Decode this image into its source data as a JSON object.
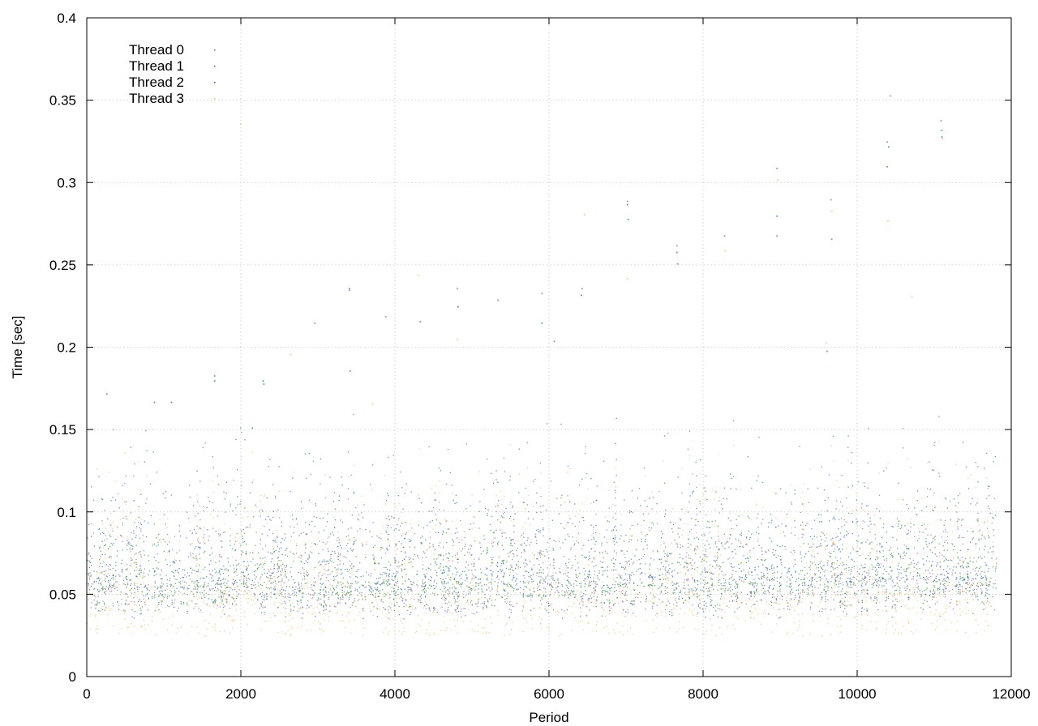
{
  "chart_data": {
    "type": "scatter",
    "title": "",
    "xlabel": "Period",
    "ylabel": "Time [sec]",
    "xlim": [
      0,
      12000
    ],
    "ylim": [
      0,
      0.4
    ],
    "x_ticks": [
      0,
      2000,
      4000,
      6000,
      8000,
      10000,
      12000
    ],
    "y_ticks": [
      0,
      0.05,
      0.1,
      0.15,
      0.2,
      0.25,
      0.3,
      0.35,
      0.4
    ],
    "x_tick_labels": [
      "0",
      "2000",
      "4000",
      "6000",
      "8000",
      "10000",
      "12000"
    ],
    "y_tick_labels": [
      "0",
      "0.05",
      "0.1",
      "0.15",
      "0.2",
      "0.25",
      "0.3",
      "0.35",
      "0.4"
    ],
    "grid": true,
    "legend_position": "top-left",
    "x_range_of_data": [
      0,
      11800
    ],
    "series": [
      {
        "name": "Thread 0",
        "color": "#9467bd",
        "summary": {
          "typical_low": 0.04,
          "typical_high": 0.11,
          "center": 0.058
        },
        "outliers": [
          [
            2950,
            0.215
          ],
          [
            3400,
            0.235
          ],
          [
            3870,
            0.219
          ],
          [
            4800,
            0.236
          ],
          [
            5900,
            0.233
          ],
          [
            6420,
            0.236
          ],
          [
            7010,
            0.289
          ],
          [
            7650,
            0.262
          ],
          [
            8270,
            0.268
          ],
          [
            8950,
            0.309
          ],
          [
            9650,
            0.29
          ],
          [
            10380,
            0.325
          ],
          [
            10420,
            0.353
          ],
          [
            11080,
            0.338
          ],
          [
            9600,
            0.198
          ]
        ]
      },
      {
        "name": "Thread 1",
        "color": "#2ca02c",
        "summary": {
          "typical_low": 0.04,
          "typical_high": 0.1,
          "center": 0.057
        },
        "outliers": [
          [
            1650,
            0.183
          ],
          [
            2290,
            0.178
          ],
          [
            3410,
            0.186
          ],
          [
            4320,
            0.216
          ],
          [
            5330,
            0.229
          ],
          [
            6060,
            0.204
          ],
          [
            7020,
            0.278
          ],
          [
            7660,
            0.251
          ],
          [
            8950,
            0.268
          ],
          [
            9660,
            0.266
          ],
          [
            10380,
            0.31
          ],
          [
            11090,
            0.332
          ]
        ]
      },
      {
        "name": "Thread 2",
        "color": "#1f77b4",
        "summary": {
          "typical_low": 0.035,
          "typical_high": 0.14,
          "center": 0.065
        },
        "outliers": [
          [
            250,
            0.172
          ],
          [
            870,
            0.167
          ],
          [
            1090,
            0.167
          ],
          [
            1650,
            0.18
          ],
          [
            2280,
            0.18
          ],
          [
            3400,
            0.236
          ],
          [
            4810,
            0.225
          ],
          [
            5900,
            0.215
          ],
          [
            6410,
            0.232
          ],
          [
            7010,
            0.287
          ],
          [
            7650,
            0.258
          ],
          [
            8950,
            0.28
          ],
          [
            10400,
            0.322
          ],
          [
            11090,
            0.328
          ]
        ]
      },
      {
        "name": "Thread 3",
        "color": "#ffbf60",
        "summary": {
          "typical_low": 0.025,
          "typical_high": 0.125,
          "center": 0.05
        },
        "outliers": [
          [
            1990,
            0.336
          ],
          [
            2640,
            0.196
          ],
          [
            3700,
            0.166
          ],
          [
            4300,
            0.244
          ],
          [
            4800,
            0.205
          ],
          [
            6450,
            0.281
          ],
          [
            7010,
            0.242
          ],
          [
            8280,
            0.259
          ],
          [
            8960,
            0.302
          ],
          [
            9660,
            0.283
          ],
          [
            10390,
            0.277
          ],
          [
            10700,
            0.231
          ],
          [
            11100,
            0.327
          ],
          [
            9590,
            0.203
          ]
        ]
      }
    ]
  }
}
